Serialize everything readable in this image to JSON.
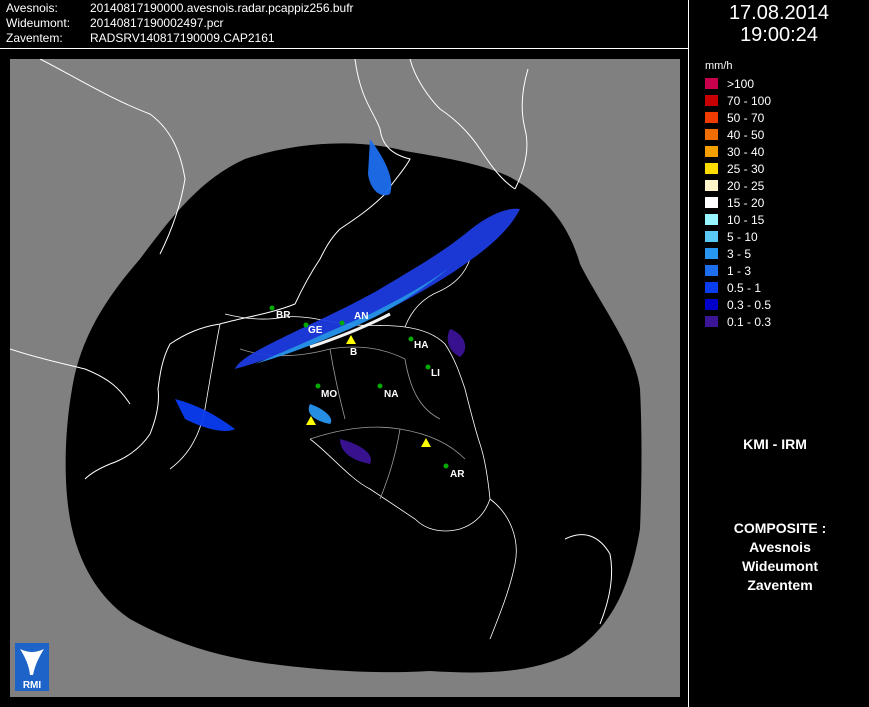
{
  "header": {
    "rows": [
      {
        "label": "Avesnois:",
        "value": "20140817190000.avesnois.radar.pcappiz256.bufr"
      },
      {
        "label": "Wideumont:",
        "value": "20140817190002497.pcr"
      },
      {
        "label": "Zaventem:",
        "value": "RADSRV140817190009.CAP2161"
      }
    ]
  },
  "datetime": {
    "date": "17.08.2014",
    "time": "19:00:24"
  },
  "legend": {
    "unit": "mm/h",
    "items": [
      {
        "label": ">100",
        "color": "#c8004b"
      },
      {
        "label": "70 - 100",
        "color": "#c80000"
      },
      {
        "label": "50 - 70",
        "color": "#f03c00"
      },
      {
        "label": "40 - 50",
        "color": "#f06e00"
      },
      {
        "label": "30 - 40",
        "color": "#f5a000"
      },
      {
        "label": "25 - 30",
        "color": "#ffdc00"
      },
      {
        "label": "20 - 25",
        "color": "#fff5c8"
      },
      {
        "label": "15 - 20",
        "color": "#ffffff"
      },
      {
        "label": "10 - 15",
        "color": "#96f5ff"
      },
      {
        "label": "5 - 10",
        "color": "#5ac8f5"
      },
      {
        "label": "3 - 5",
        "color": "#2896f0"
      },
      {
        "label": "1 - 3",
        "color": "#1e6ef0"
      },
      {
        "label": "0.5 - 1",
        "color": "#0a3cf0"
      },
      {
        "label": "0.3 - 0.5",
        "color": "#0000c8"
      },
      {
        "label": "0.1 - 0.3",
        "color": "#3c1496"
      }
    ]
  },
  "map": {
    "background_color": "#808080",
    "coverage_color": "#000000",
    "province_labels": [
      "BR",
      "GE",
      "AN",
      "B",
      "HA",
      "LI",
      "MO",
      "NA",
      "AR"
    ],
    "radar_marker_color": "#ffff00",
    "city_marker_color": "#00aa00"
  },
  "organization": "KMI - IRM",
  "composite": {
    "title": "COMPOSITE :",
    "items": [
      "Avesnois",
      "Wideumont",
      "Zaventem"
    ]
  },
  "logo": {
    "text": "RMI",
    "color": "#1e64c8"
  }
}
